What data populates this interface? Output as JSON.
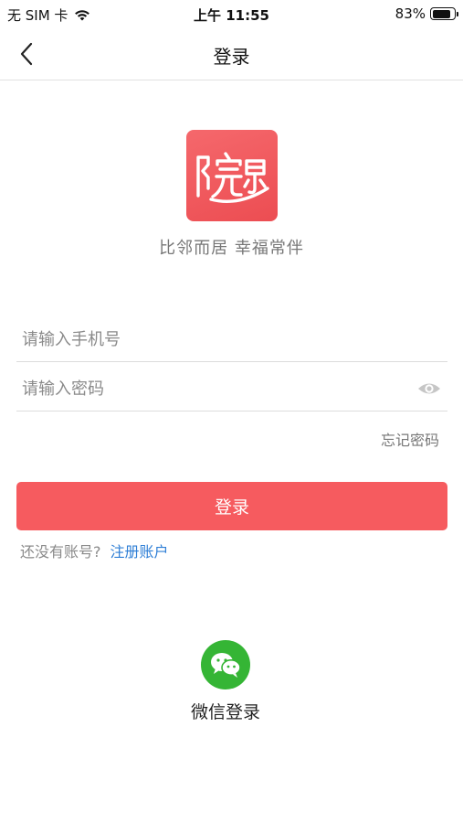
{
  "status_bar": {
    "carrier": "无 SIM 卡",
    "time": "上午 11:55",
    "battery": "83%",
    "battery_level": 0.83,
    "icons": [
      "wifi-icon",
      "battery-icon"
    ]
  },
  "nav": {
    "back_icon": "chevron-left-icon",
    "title": "登录"
  },
  "logo": {
    "icon": "app-logo",
    "colors": {
      "tile": "#f1595d",
      "mark": "#ffffff"
    }
  },
  "slogan": "比邻而居 幸福常伴",
  "form": {
    "phone": {
      "placeholder": "请输入手机号",
      "value": ""
    },
    "password": {
      "placeholder": "请输入密码",
      "value": "",
      "toggle_icon": "eye-icon"
    },
    "forgot_label": "忘记密码",
    "login_label": "登录"
  },
  "register": {
    "prompt": "还没有账号?",
    "link": "注册账户"
  },
  "wechat": {
    "icon": "wechat-icon",
    "label": "微信登录"
  },
  "colors": {
    "primary": "#f65b5f",
    "link": "#2f7fd6",
    "wechat": "#35b535",
    "muted_text": "#8a8a8a",
    "divider": "#dcdcdc"
  }
}
